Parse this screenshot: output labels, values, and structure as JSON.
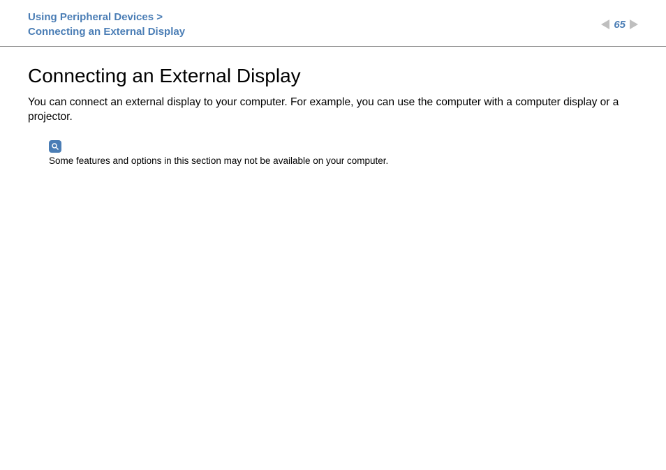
{
  "header": {
    "breadcrumb_section": "Using Peripheral Devices",
    "breadcrumb_sep": " >",
    "breadcrumb_page": "Connecting an External Display",
    "page_number": "65"
  },
  "main": {
    "title": "Connecting an External Display",
    "paragraph": "You can connect an external display to your computer. For example, you can use the computer with a computer display or a projector.",
    "note": "Some features and options in this section may not be available on your computer."
  }
}
